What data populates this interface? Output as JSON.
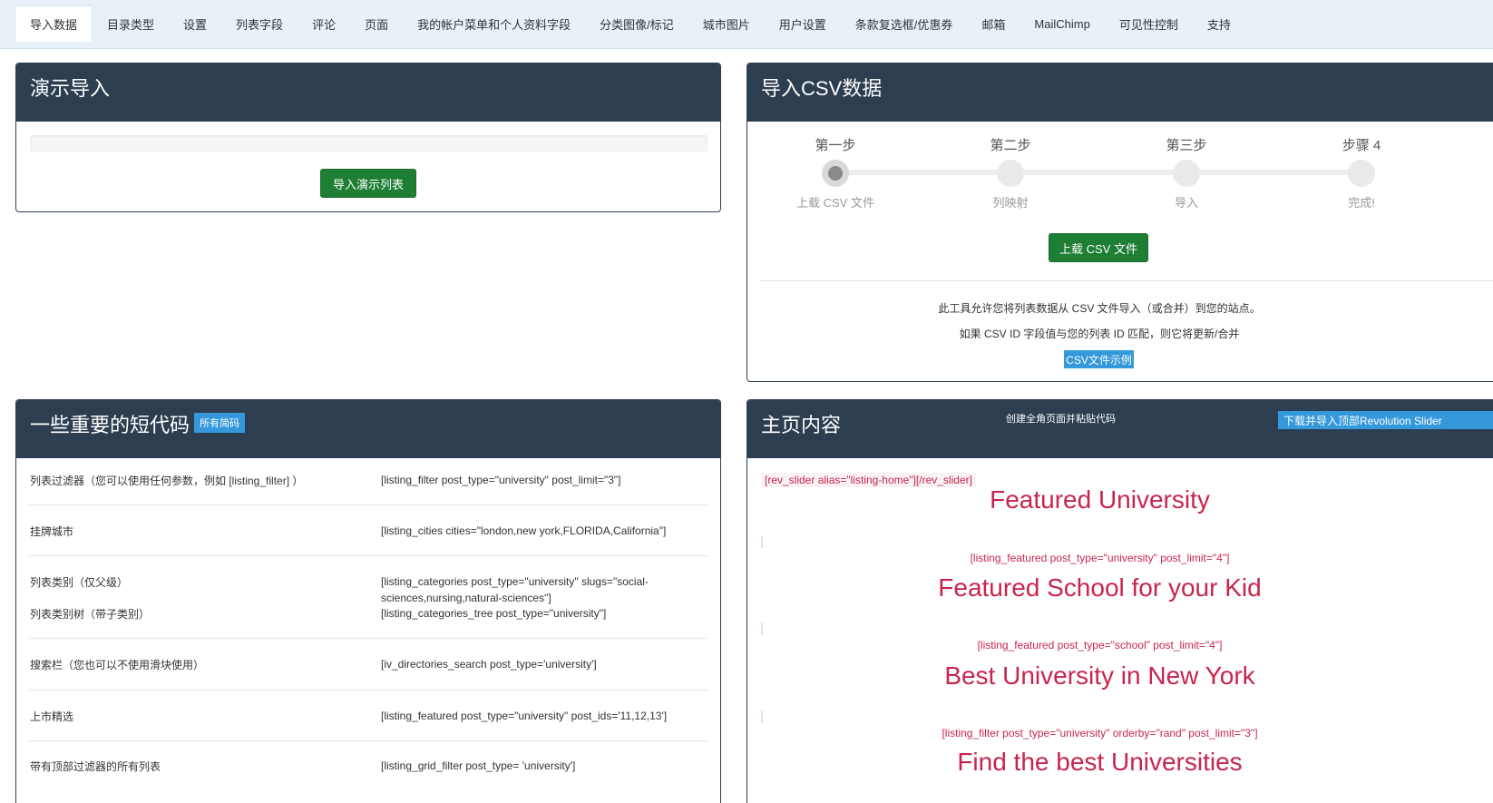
{
  "tabs": [
    {
      "label": "导入数据",
      "active": true
    },
    {
      "label": "目录类型"
    },
    {
      "label": "设置"
    },
    {
      "label": "列表字段"
    },
    {
      "label": "评论"
    },
    {
      "label": "页面"
    },
    {
      "label": "我的帐户菜单和个人资料字段"
    },
    {
      "label": "分类图像/标记"
    },
    {
      "label": "城市图片"
    },
    {
      "label": "用户设置"
    },
    {
      "label": "条款复选框/优惠券"
    },
    {
      "label": "邮箱"
    },
    {
      "label": "MailChimp"
    },
    {
      "label": "可见性控制"
    },
    {
      "label": "支持"
    }
  ],
  "demo": {
    "title": "演示导入",
    "progress": 0,
    "button": "导入演示列表"
  },
  "csv": {
    "title": "导入CSV数据",
    "steps": [
      {
        "name": "第一步",
        "sub": "上载 CSV 文件",
        "active": true
      },
      {
        "name": "第二步",
        "sub": "列映射"
      },
      {
        "name": "第三步",
        "sub": "导入"
      },
      {
        "name": "步骤 4",
        "sub": "完成!"
      }
    ],
    "upload_button": "上载 CSV 文件",
    "desc1": "此工具允许您将列表数据从 CSV 文件导入（或合并）到您的站点。",
    "desc2": "如果 CSV ID 字段值与您的列表 ID 匹配，则它将更新/合并",
    "example_button": "CSV文件示例"
  },
  "shortcodes": {
    "title": "一些重要的短代码",
    "badge": "所有简码",
    "rows": [
      {
        "label": "列表过滤器（您可以使用任何参数，例如 [listing_filter] ）",
        "code": "[listing_filter post_type=\"university\" post_limit=\"3\"]"
      },
      {
        "label": "挂牌城市",
        "code": "[listing_cities cities=\"london,new york,FLORIDA,California\"]"
      },
      {
        "label": "列表类别（仅父级）",
        "label2": "列表类别树（带子类别）",
        "code": "[listing_categories post_type=\"university\" slugs=\"social-sciences,nursing,natural-sciences\"]",
        "code2": "[listing_categories_tree post_type=\"university\"]"
      },
      {
        "label": "搜索栏（您也可以不使用滑块使用）",
        "code": "[iv_directories_search post_type='university']"
      },
      {
        "label": "上市精选",
        "code": "[listing_featured post_type=\"university\" post_ids='11,12,13']"
      },
      {
        "label": "带有顶部过滤器的所有列表",
        "code": "[listing_grid_filter post_type= 'university']"
      }
    ]
  },
  "home": {
    "title": "主页内容",
    "center_text": "创建全角页面并粘贴代码",
    "download_button": "下载并导入顶部Revolution Slider",
    "slider_code": "[rev_slider alias=\"listing-home\"][/rev_slider]",
    "sections": [
      {
        "title": "Featured University",
        "code": "[listing_featured post_type=\"university\" post_limit=\"4\"]"
      },
      {
        "title": "Featured School for your Kid",
        "code": "[listing_featured post_type=\"school\" post_limit=\"4\"]"
      },
      {
        "title": "Best University in New York",
        "code": "[listing_filter post_type=\"university\" orderby=\"rand\" post_limit=\"3\"]"
      },
      {
        "title": "Find the best Universities"
      }
    ]
  }
}
